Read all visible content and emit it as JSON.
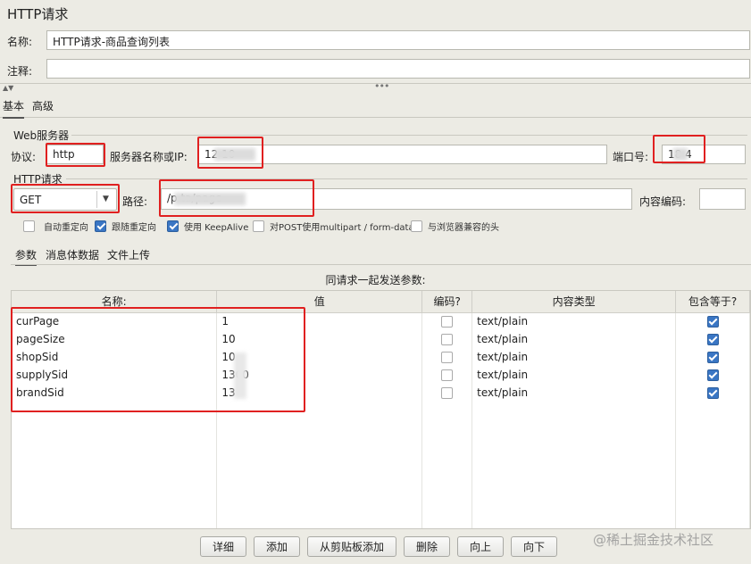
{
  "panel_title": "HTTP请求",
  "name": {
    "label": "名称:",
    "value": "HTTP请求-商品查询列表"
  },
  "comment": {
    "label": "注释:",
    "value": ""
  },
  "tabs": [
    {
      "label": "基本"
    },
    {
      "label": "高级"
    }
  ],
  "web_server": {
    "title": "Web服务器",
    "protocol_label": "协议:",
    "protocol_value": "http",
    "server_label": "服务器名称或IP:",
    "server_value": "12        10",
    "port_label": "端口号:",
    "port_value": "18   4"
  },
  "http_request": {
    "title": "HTTP请求",
    "method": "GET",
    "path_label": "路径:",
    "path_value": "/p          ta/page",
    "encoding_label": "内容编码:",
    "encoding_value": ""
  },
  "options": [
    {
      "label": "自动重定向",
      "checked": false
    },
    {
      "label": "跟随重定向",
      "checked": true
    },
    {
      "label": "使用 KeepAlive",
      "checked": true
    },
    {
      "label": "对POST使用multipart / form-data",
      "checked": false
    },
    {
      "label": "与浏览器兼容的头",
      "checked": false
    }
  ],
  "subtabs": [
    {
      "label": "参数"
    },
    {
      "label": "消息体数据"
    },
    {
      "label": "文件上传"
    }
  ],
  "params_caption": "同请求一起发送参数:",
  "table_headers": [
    "名称:",
    "值",
    "编码?",
    "内容类型",
    "包含等于?"
  ],
  "rows": [
    {
      "name": "curPage",
      "value": "1",
      "encode": false,
      "content_type": "text/plain",
      "include_equals": true
    },
    {
      "name": "pageSize",
      "value": "10",
      "encode": false,
      "content_type": "text/plain",
      "include_equals": true
    },
    {
      "name": "shopSid",
      "value": "10",
      "encode": false,
      "content_type": "text/plain",
      "include_equals": true
    },
    {
      "name": "supplySid",
      "value": "1300",
      "encode": false,
      "content_type": "text/plain",
      "include_equals": true
    },
    {
      "name": "brandSid",
      "value": "13",
      "encode": false,
      "content_type": "text/plain",
      "include_equals": true
    }
  ],
  "buttons": [
    "详细",
    "添加",
    "从剪贴板添加",
    "删除",
    "向上",
    "向下"
  ],
  "watermark": "@稀土掘金技术社区"
}
